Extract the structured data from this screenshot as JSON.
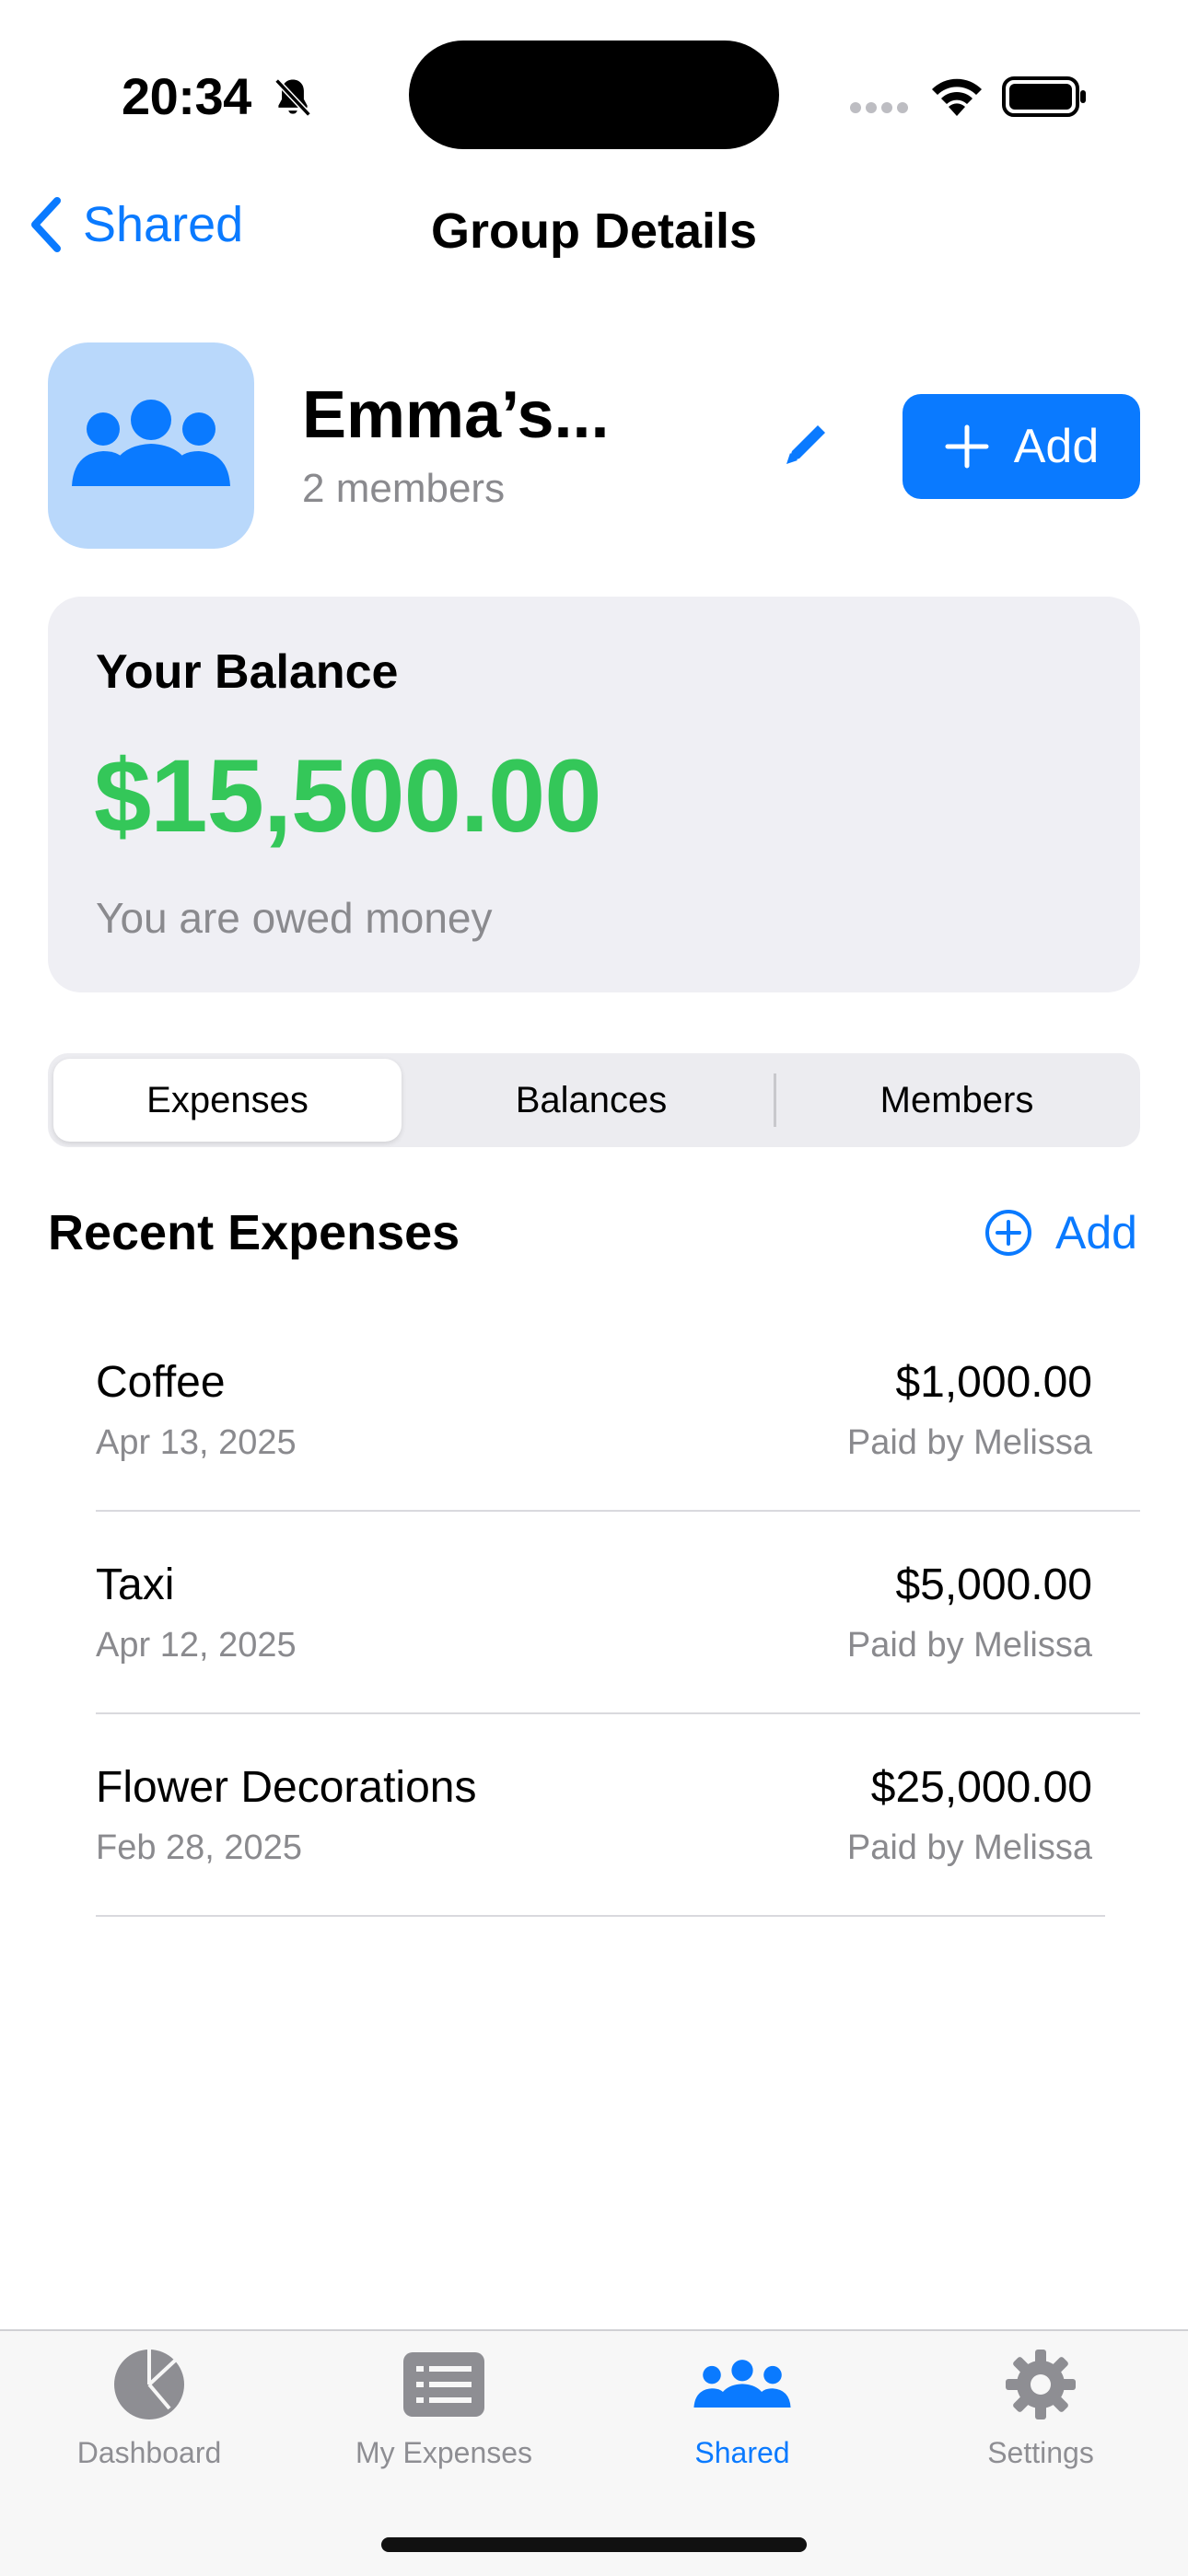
{
  "status_bar": {
    "time": "20:34"
  },
  "nav": {
    "back_label": "Shared",
    "title": "Group Details"
  },
  "group": {
    "name": "Emma’s...",
    "members": "2 members",
    "add_label": "Add"
  },
  "balance": {
    "label": "Your Balance",
    "amount": "$15,500.00",
    "note": "You are owed money"
  },
  "segments": [
    "Expenses",
    "Balances",
    "Members"
  ],
  "recent": {
    "title": "Recent Expenses",
    "add_label": "Add",
    "items": [
      {
        "name": "Coffee",
        "date": "Apr 13, 2025",
        "amount": "$1,000.00",
        "payer": "Paid by Melissa"
      },
      {
        "name": "Taxi",
        "date": "Apr 12, 2025",
        "amount": "$5,000.00",
        "payer": "Paid by Melissa"
      },
      {
        "name": "Flower Decorations",
        "date": "Feb 28, 2025",
        "amount": "$25,000.00",
        "payer": "Paid by Melissa"
      }
    ]
  },
  "tabs": [
    {
      "label": "Dashboard",
      "icon": "pie-chart-icon"
    },
    {
      "label": "My Expenses",
      "icon": "list-icon"
    },
    {
      "label": "Shared",
      "icon": "people-icon",
      "active": true
    },
    {
      "label": "Settings",
      "icon": "gear-icon"
    }
  ],
  "colors": {
    "accent": "#0a7aff",
    "positive": "#34c759",
    "card": "#efeff4"
  }
}
